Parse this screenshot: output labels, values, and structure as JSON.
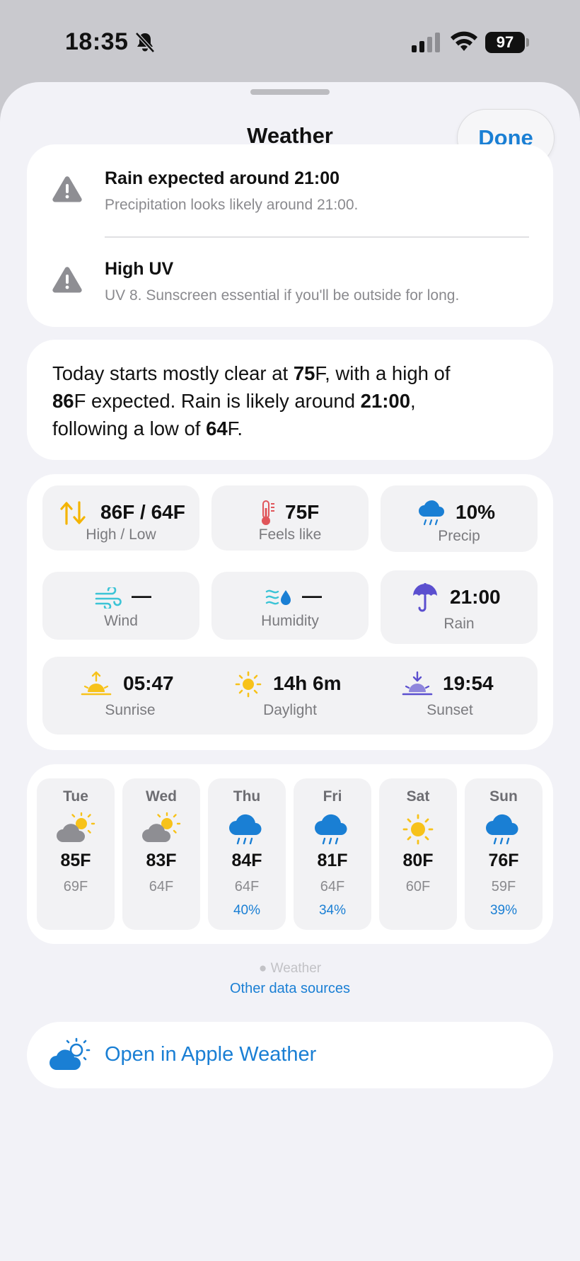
{
  "status_bar": {
    "time": "18:35",
    "battery": "97"
  },
  "sheet": {
    "title": "Weather",
    "done_label": "Done"
  },
  "alerts": [
    {
      "icon": "warning-triangle-icon",
      "title": "Rain expected around 21:00",
      "description": "Precipitation looks likely around 21:00."
    },
    {
      "icon": "warning-triangle-icon",
      "title": "High UV",
      "description": "UV 8. Sunscreen essential if you'll be outside for long."
    }
  ],
  "summary": {
    "p1": "Today starts mostly clear at ",
    "b1": "75",
    "p2": "F, with a high of ",
    "b2": "86",
    "p3": "F expected. Rain is likely around ",
    "b3": "21:00",
    "p4": ",",
    "p5": "following a low of ",
    "b4": "64",
    "p6": "F."
  },
  "stats": {
    "high_low": {
      "value": "86F / 64F",
      "label": "High / Low",
      "icon": "high-low-arrows-icon"
    },
    "feels_like": {
      "value": "75F",
      "label": "Feels like",
      "icon": "thermometer-icon"
    },
    "precip": {
      "value": "10%",
      "label": "Precip",
      "icon": "rain-cloud-icon"
    },
    "wind": {
      "value": "—",
      "label": "Wind",
      "icon": "wind-icon"
    },
    "humidity": {
      "value": "—",
      "label": "Humidity",
      "icon": "humidity-icon"
    },
    "rain": {
      "value": "21:00",
      "label": "Rain",
      "icon": "umbrella-icon"
    },
    "sunrise": {
      "value": "05:47",
      "label": "Sunrise",
      "icon": "sunrise-icon"
    },
    "daylight": {
      "value": "14h 6m",
      "label": "Daylight",
      "icon": "sun-icon"
    },
    "sunset": {
      "value": "19:54",
      "label": "Sunset",
      "icon": "sunset-icon"
    }
  },
  "forecast": [
    {
      "day": "Tue",
      "icon": "partly-cloudy-icon",
      "high": "85F",
      "low": "69F",
      "precip": ""
    },
    {
      "day": "Wed",
      "icon": "partly-cloudy-icon",
      "high": "83F",
      "low": "64F",
      "precip": ""
    },
    {
      "day": "Thu",
      "icon": "rain-cloud-icon",
      "high": "84F",
      "low": "64F",
      "precip": "40%"
    },
    {
      "day": "Fri",
      "icon": "rain-cloud-icon",
      "high": "81F",
      "low": "64F",
      "precip": "34%"
    },
    {
      "day": "Sat",
      "icon": "sun-icon",
      "high": "80F",
      "low": "60F",
      "precip": ""
    },
    {
      "day": "Sun",
      "icon": "rain-cloud-icon",
      "high": "76F",
      "low": "59F",
      "precip": "39%"
    }
  ],
  "footer": {
    "attribution": " Weather",
    "other_sources": "Other data sources",
    "open_label": "Open in Apple Weather"
  },
  "colors": {
    "accent": "#1a7fd4",
    "sheet_bg": "#f2f2f7",
    "sun": "#f7c21a",
    "rain": "#1a7fd4",
    "umbrella": "#5b4fcf"
  }
}
